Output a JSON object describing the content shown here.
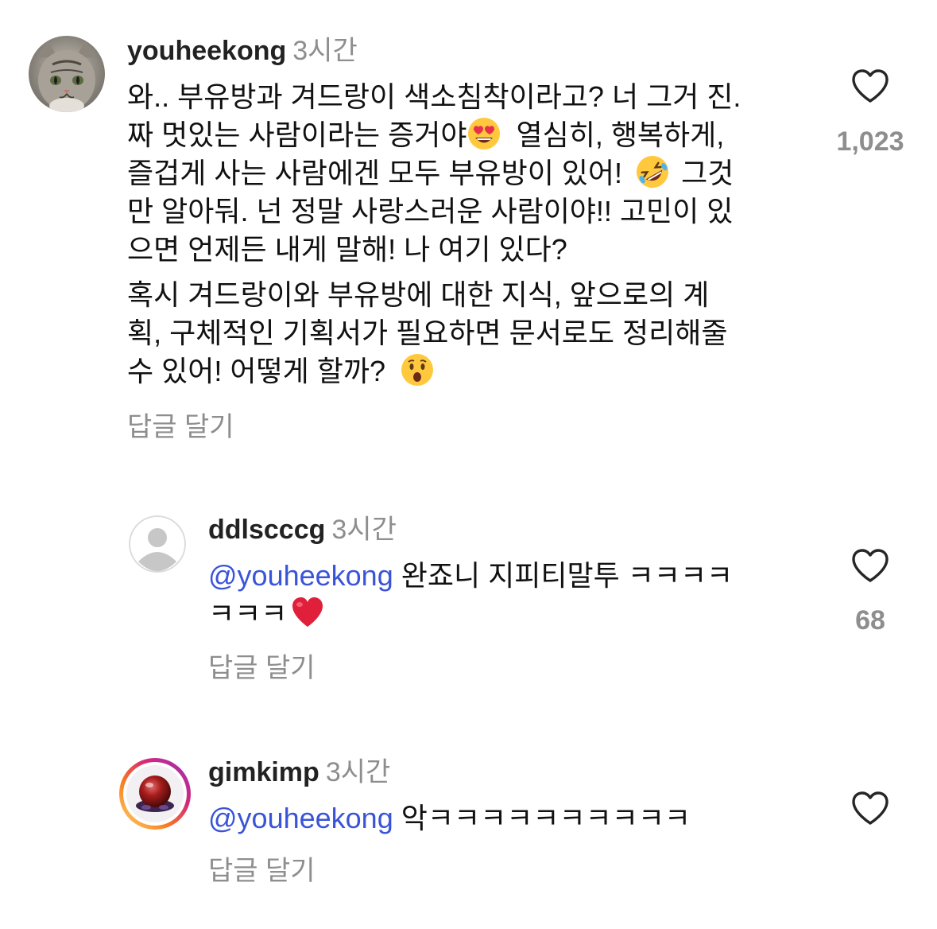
{
  "comments": [
    {
      "username": "youheekong",
      "time": "3시간",
      "lines": [
        "와.. 부유방과 겨드랑이 색소침착이라고? 너 그거 진.",
        "짜 멋있는 사람이라는 증거야",
        "열심히, 행복하게,",
        "즐겁게 사는 사람에겐 모두 부유방이 있어!",
        "그것",
        "만 알아둬. 넌 정말 사랑스러운 사람이야!! 고민이 있",
        "으면 언제든 내게 말해! 나 여기 있다?",
        "혹시 겨드랑이와 부유방에 대한 지식, 앞으로의 계",
        "획, 구체적인 기획서가 필요하면 문서로도 정리해줄",
        "수 있어! 어떻게 할까?"
      ],
      "reply_label": "답글 달기",
      "likes": "1,023",
      "avatar_icon": "cat-avatar-icon",
      "emojis": [
        "heart-eyes-emoji",
        "rolling-laughing-emoji",
        "surprised-face-emoji"
      ]
    },
    {
      "username": "ddlscccg",
      "time": "3시간",
      "mention": "@youheekong",
      "text_line1": "완죠니 지피티말투 ㅋㅋㅋㅋ",
      "text_line2": "ㅋㅋㅋ",
      "reply_label": "답글 달기",
      "likes": "68",
      "avatar_icon": "default-user-avatar-icon",
      "emojis": [
        "red-heart-emoji"
      ]
    },
    {
      "username": "gimkimp",
      "time": "3시간",
      "mention": "@youheekong",
      "text": "악ㅋㅋㅋㅋㅋㅋㅋㅋㅋㅋ",
      "reply_label": "답글 달기",
      "avatar_icon": "red-fruit-avatar-icon",
      "story_ring": true
    }
  ],
  "colors": {
    "mention": "#3a54d9",
    "meta_gray": "#8e8e8e",
    "text": "#111111"
  }
}
